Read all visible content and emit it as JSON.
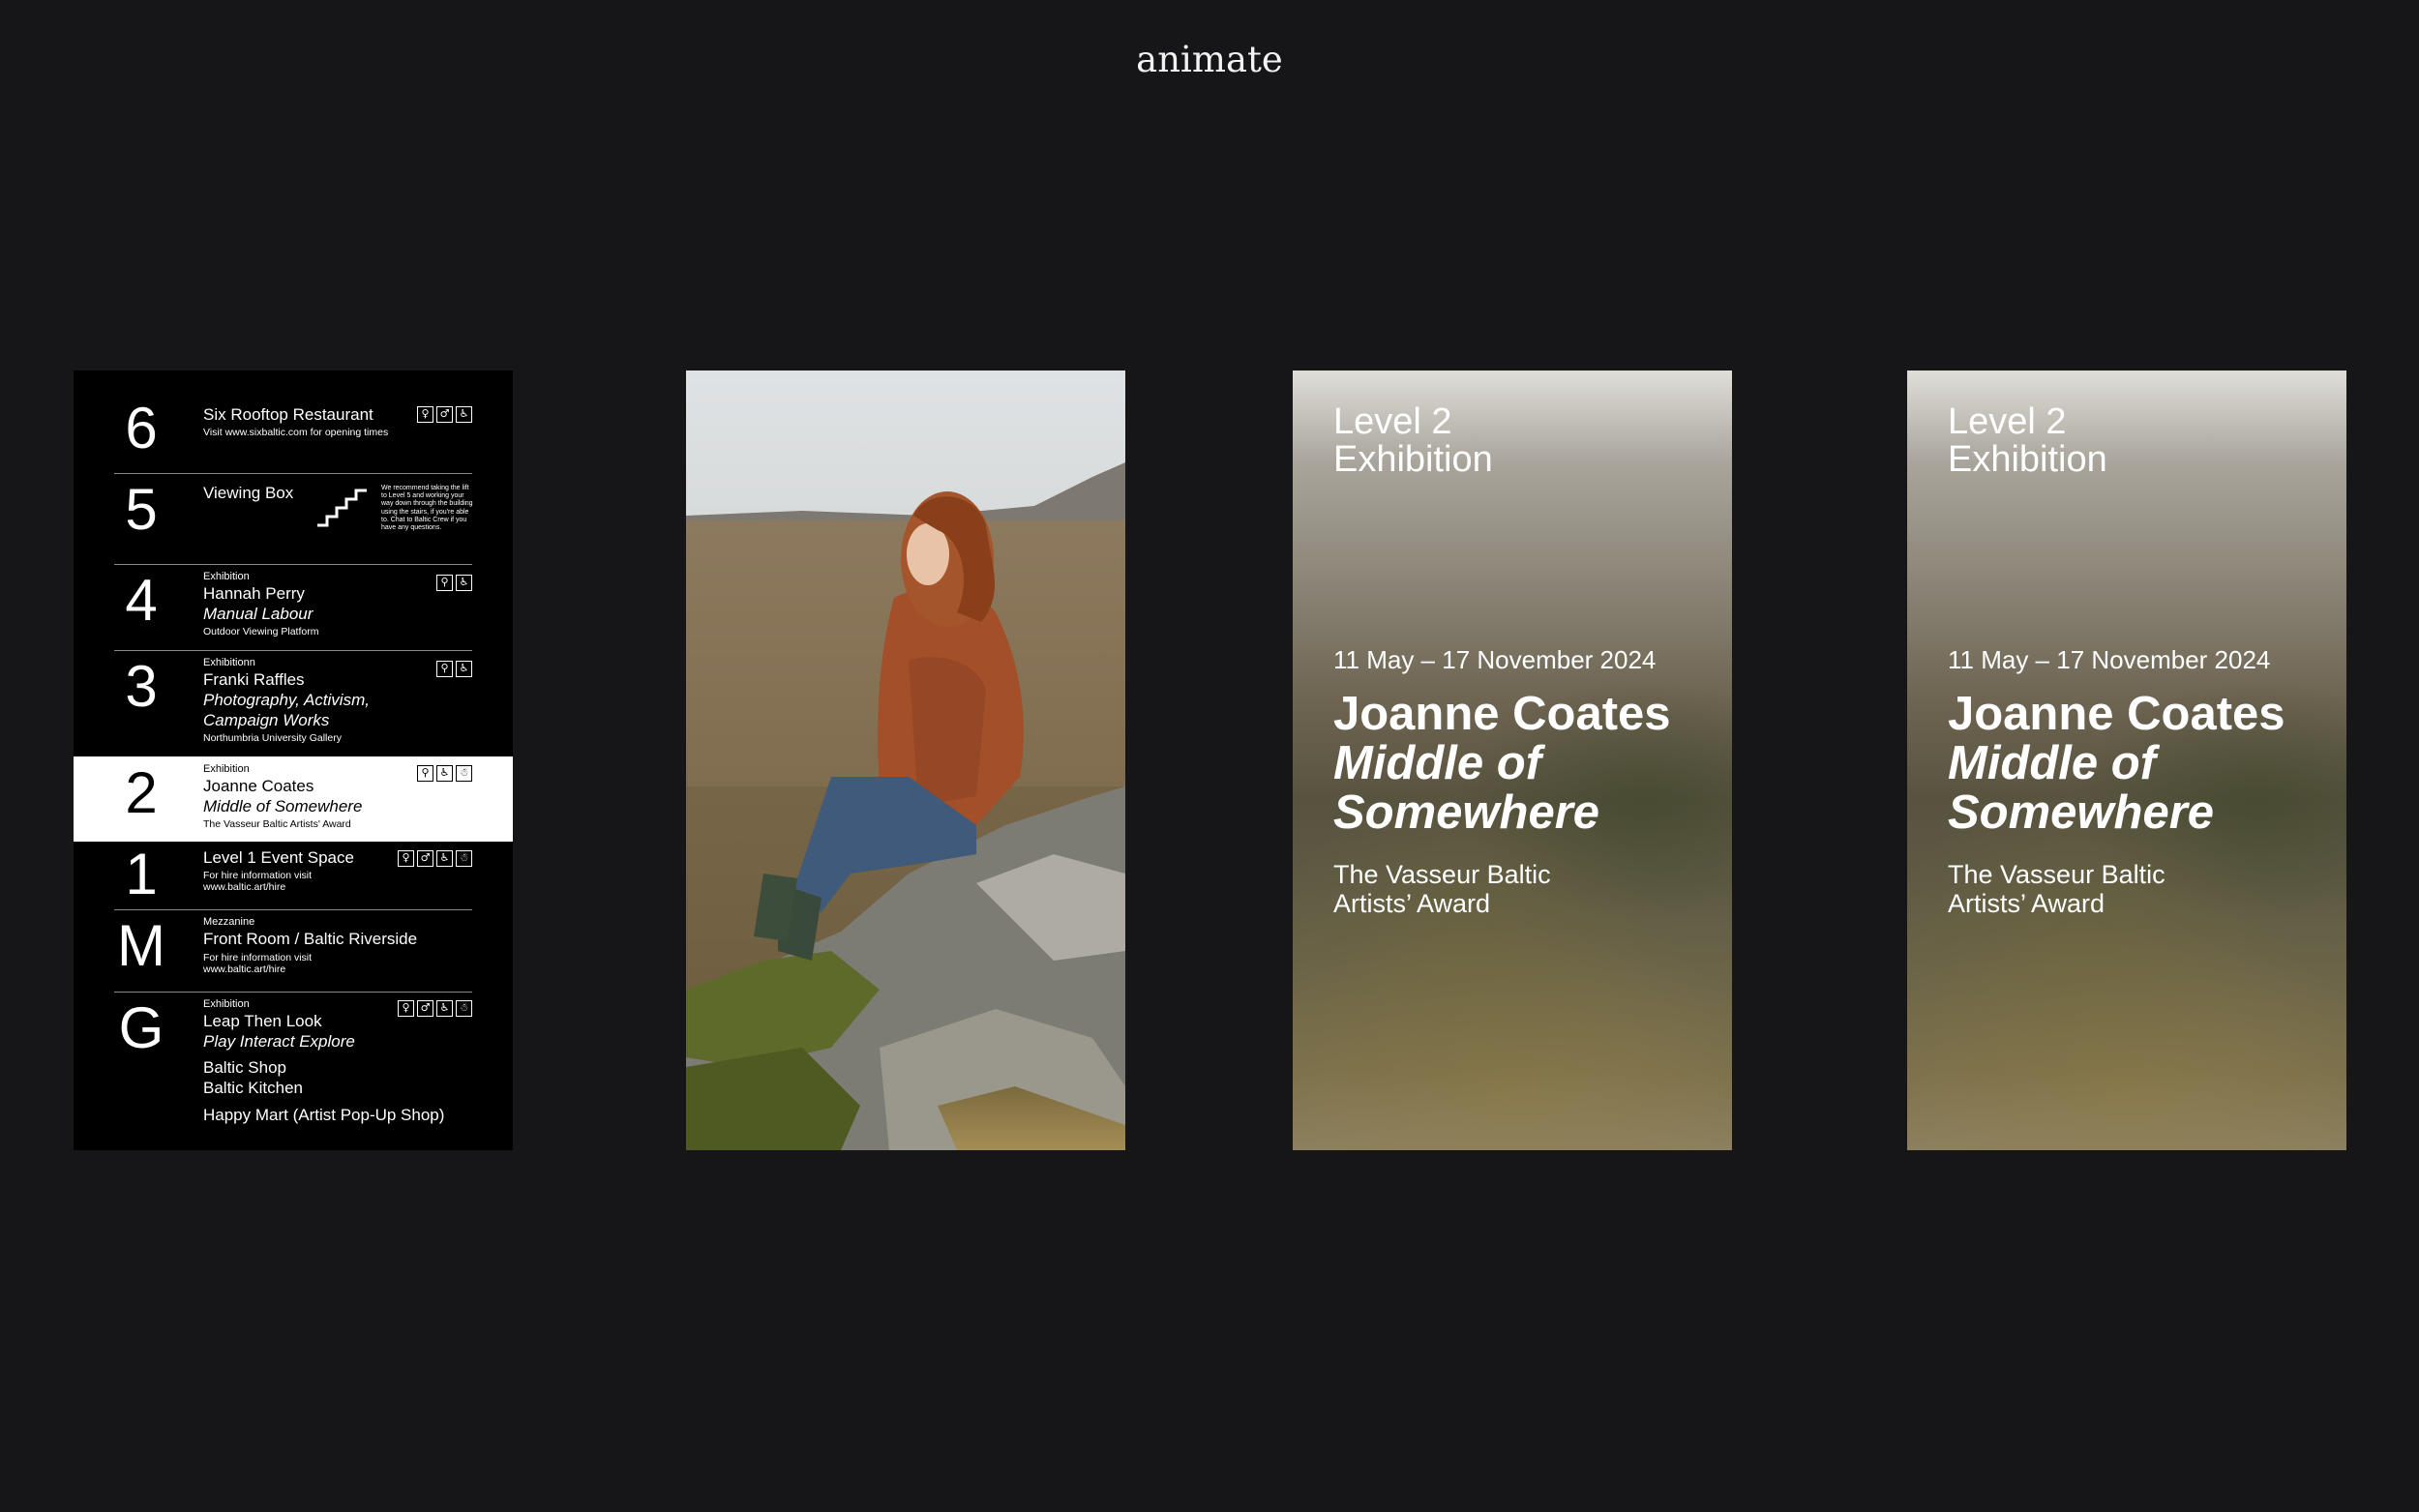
{
  "page": {
    "title": "animate"
  },
  "directory": {
    "floors": [
      {
        "number": "6",
        "name": "Six Rooftop Restaurant",
        "note": "Visit www.sixbaltic.com for opening times",
        "icons": [
          "toilet-icon",
          "toilet-icon",
          "wheelchair-icon"
        ]
      },
      {
        "number": "5",
        "name": "Viewing Box",
        "stairs_note": "We recommend taking the lift to Level 5 and working your way down through the building using the stairs, if you're able to. Chat to Baltic Crew if you have any questions.",
        "icons": [
          "stairs-icon"
        ]
      },
      {
        "number": "4",
        "label": "Exhibition",
        "name": "Hannah Perry",
        "subtitle": "Manual Labour",
        "note": "Outdoor Viewing Platform",
        "icons": [
          "accessible-toilet-icon",
          "wheelchair-icon"
        ]
      },
      {
        "number": "3",
        "label": "Exhibitionn",
        "name": "Franki Raffles",
        "subtitle_line1": "Photography, Activism,",
        "subtitle_line2": "Campaign Works",
        "note": "Northumbria University Gallery",
        "icons": [
          "accessible-toilet-icon",
          "wheelchair-icon"
        ]
      },
      {
        "number": "2",
        "label": "Exhibition",
        "name": "Joanne Coates",
        "subtitle": "Middle of Somewhere",
        "note": "The Vasseur Baltic Artists' Award",
        "active": true,
        "icons": [
          "accessible-toilet-icon",
          "wheelchair-icon",
          "baby-change-icon"
        ]
      },
      {
        "number": "1",
        "name": "Level 1 Event Space",
        "note_line1": "For hire information visit",
        "note_line2": "www.baltic.art/hire",
        "icons": [
          "toilet-icon",
          "toilet-icon",
          "wheelchair-icon",
          "baby-change-icon"
        ]
      },
      {
        "number": "M",
        "label": "Mezzanine",
        "name": "Front Room / Baltic Riverside",
        "note_line1": "For hire information visit",
        "note_line2": "www.baltic.art/hire"
      },
      {
        "number": "G",
        "label": "Exhibition",
        "name": "Leap Then Look",
        "subtitle": "Play Interact Explore",
        "extra1": "Baltic Shop",
        "extra2": "Baltic Kitchen",
        "extra3": "Happy Mart (Artist Pop-Up Shop)",
        "icons": [
          "toilet-icon",
          "toilet-icon",
          "wheelchair-icon",
          "baby-change-icon"
        ]
      }
    ]
  },
  "poster": {
    "level_line1": "Level 2",
    "level_line2": "Exhibition",
    "dates": "11 May – 17 November 2024",
    "artist": "Joanne Coates",
    "title_line1": "Middle of",
    "title_line2": "Somewhere",
    "award_line1": "The Vasseur Baltic",
    "award_line2": "Artists’ Award"
  },
  "colors": {
    "background": "#161518",
    "directory_bg": "#000000",
    "active_floor": "#ffffff"
  }
}
